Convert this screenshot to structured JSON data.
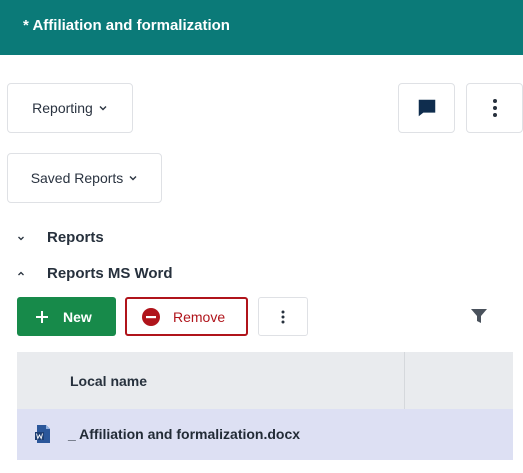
{
  "header": {
    "title": "* Affiliation and formalization"
  },
  "toolbar": {
    "reporting_label": "Reporting",
    "saved_reports_label": "Saved Reports",
    "icons": {
      "comment": "comment-icon",
      "more": "more-vertical-icon"
    }
  },
  "sections": [
    {
      "label": "Reports",
      "expanded": false
    },
    {
      "label": "Reports MS Word",
      "expanded": true
    }
  ],
  "actions": {
    "new_label": "New",
    "remove_label": "Remove",
    "icons": {
      "new": "plus-icon",
      "remove": "minus-circle-icon",
      "more": "more-vertical-icon",
      "filter": "filter-icon"
    }
  },
  "table": {
    "columns": [
      "Local name",
      ""
    ],
    "rows": [
      {
        "name": "_ Affiliation and formalization.docx",
        "icon": "word-doc-icon",
        "selected": true
      }
    ]
  },
  "colors": {
    "header": "#0b7a78",
    "primary": "#178a4a",
    "danger": "#b0141b",
    "selected_row": "#dde0f3",
    "table_header": "#e9ebee"
  }
}
